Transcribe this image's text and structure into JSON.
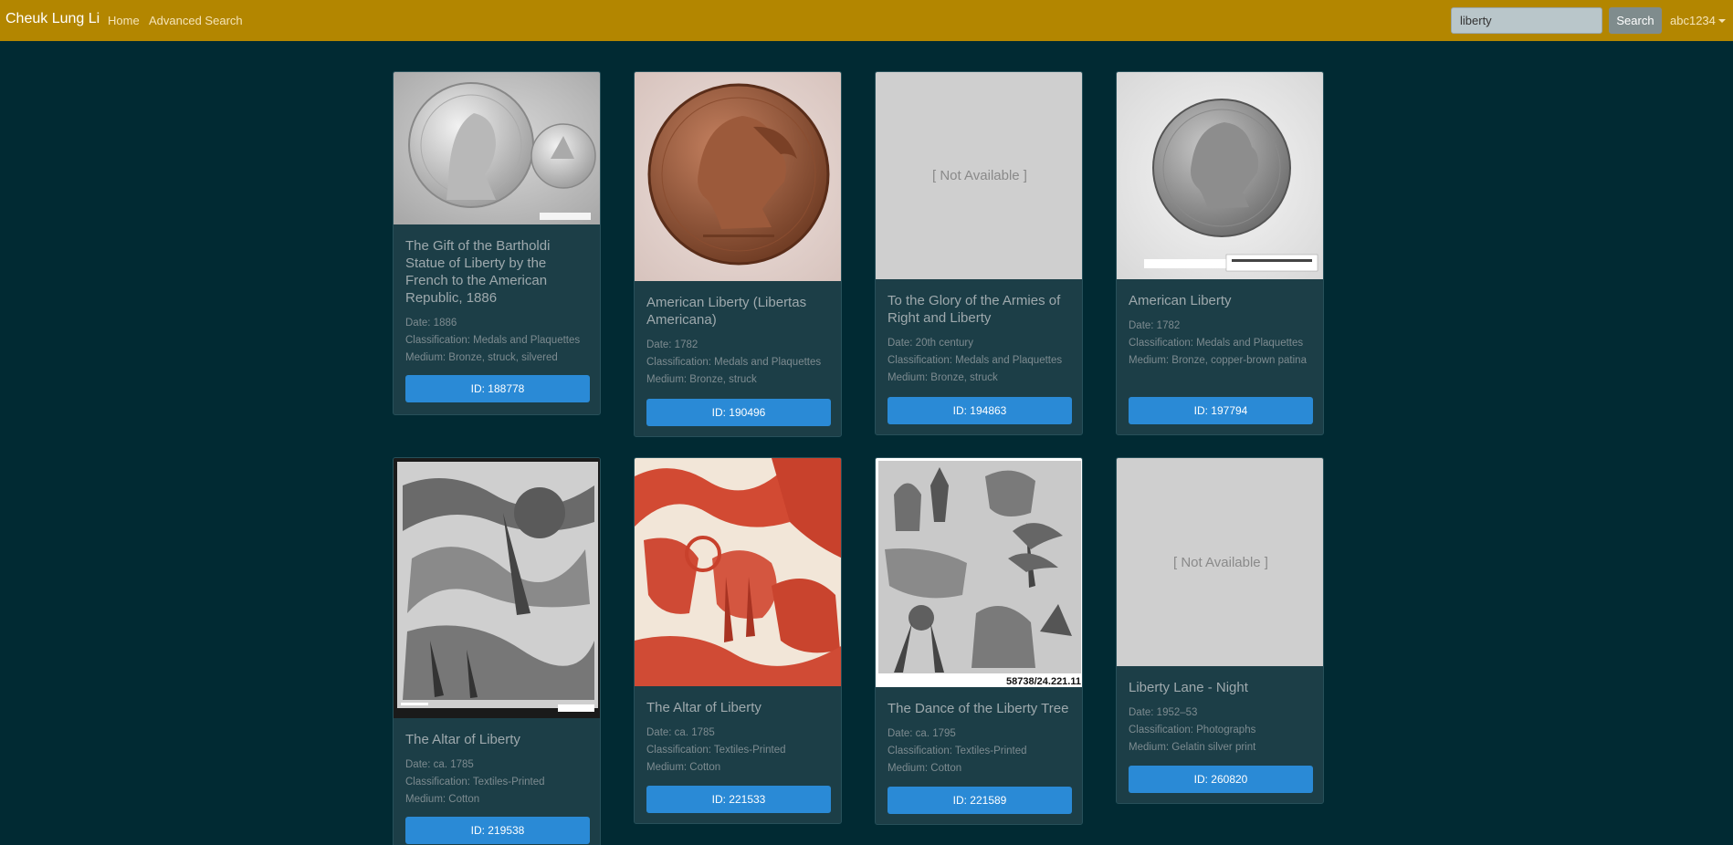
{
  "navbar": {
    "brand": "Cheuk Lung Li",
    "home": "Home",
    "advanced_search": "Advanced Search",
    "search_value": "liberty",
    "search_button": "Search",
    "user": "abc1234"
  },
  "cards": [
    {
      "title": "The Gift of the Bartholdi Statue of Liberty by the French to the American Republic, 1886",
      "date": "Date: 1886",
      "classification": "Classification: Medals and Plaquettes",
      "medium": "Medium: Bronze, struck, silvered",
      "id": "ID: 188778"
    },
    {
      "title": "American Liberty (Libertas Americana)",
      "date": "Date: 1782",
      "classification": "Classification: Medals and Plaquettes",
      "medium": "Medium: Bronze, struck",
      "id": "ID: 190496"
    },
    {
      "title": "To the Glory of the Armies of Right and Liberty",
      "date": "Date: 20th century",
      "classification": "Classification: Medals and Plaquettes",
      "medium": "Medium: Bronze, struck",
      "id": "ID: 194863",
      "image": "[ Not Available ]"
    },
    {
      "title": "American Liberty",
      "date": "Date: 1782",
      "classification": "Classification: Medals and Plaquettes",
      "medium": "Medium: Bronze, copper-brown patina",
      "id": "ID: 197794"
    },
    {
      "title": "The Altar of Liberty",
      "date": "Date: ca. 1785",
      "classification": "Classification: Textiles-Printed",
      "medium": "Medium: Cotton",
      "id": "ID: 219538"
    },
    {
      "title": "The Altar of Liberty",
      "date": "Date: ca. 1785",
      "classification": "Classification: Textiles-Printed",
      "medium": "Medium: Cotton",
      "id": "ID: 221533"
    },
    {
      "title": "The Dance of the Liberty Tree",
      "date": "Date: ca. 1795",
      "classification": "Classification: Textiles-Printed",
      "medium": "Medium: Cotton",
      "id": "ID: 221589",
      "image_caption": "58738/24.221.11"
    },
    {
      "title": "Liberty Lane - Night",
      "date": "Date: 1952–53",
      "classification": "Classification: Photographs",
      "medium": "Medium: Gelatin silver print",
      "id": "ID: 260820",
      "image": "[ Not Available ]"
    }
  ],
  "colors": {
    "navbar": "#b38600",
    "page": "#012a33",
    "card": "#1c3e47",
    "button": "#2a8ad6"
  }
}
